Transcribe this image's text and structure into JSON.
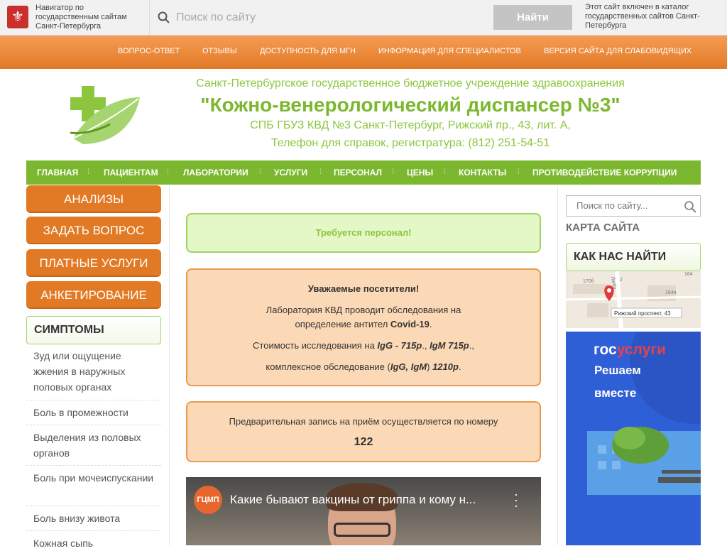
{
  "topbar": {
    "navigator_text": "Навигатор по государственным сайтам Санкт-Петербурга",
    "search_placeholder": "Поиск по сайту",
    "search_button": "Найти",
    "catalog_text": "Этот сайт включен в каталог государственных сайтов Санкт-Петербурга"
  },
  "topnav": [
    "ВОПРОС-ОТВЕТ",
    "ОТЗЫВЫ",
    "ДОСТУПНОСТЬ ДЛЯ МГН",
    "ИНФОРМАЦИЯ ДЛЯ СПЕЦИАЛИСТОВ",
    "ВЕРСИЯ САЙТА ДЛЯ СЛАБОВИДЯЩИХ"
  ],
  "header": {
    "line1": "Санкт-Петербургское государственное бюджетное учреждение здравоохранения",
    "line2": "\"Кожно-венерологический диспансер №3\"",
    "line3": "СПБ ГБУЗ КВД №3 Санкт-Петербург, Рижский пр., 43, лит. А,",
    "line4": "Телефон для справок, регистратура: (812) 251-54-51"
  },
  "mainnav": [
    "ГЛАВНАЯ",
    "ПАЦИЕНТАМ",
    "ЛАБОРАТОРИИ",
    "УСЛУГИ",
    "ПЕРСОНАЛ",
    "ЦЕНЫ",
    "КОНТАКТЫ",
    "ПРОТИВОДЕЙСТВИЕ КОРРУПЦИИ"
  ],
  "left": {
    "buttons": [
      "АНАЛИЗЫ",
      "ЗАДАТЬ ВОПРОС",
      "ПЛАТНЫЕ УСЛУГИ",
      "АНКЕТИРОВАНИЕ"
    ],
    "symptoms_title": "СИМПТОМЫ",
    "symptoms": [
      "Зуд или ощущение жжения в наружных половых органах",
      "Боль в промежности",
      "Выделения из половых органов",
      "Боль при мочеиспускании",
      "Боль внизу живота",
      "Кожная сыпь"
    ]
  },
  "center": {
    "staff_notice": "Требуется персонал!",
    "notice1": {
      "title": "Уважаемые посетители!",
      "line1": "Лаборатория КВД проводит обследования на",
      "line2a": "определение антител ",
      "line2b": "Covid-19",
      "line2c": ".",
      "line3a": "Стоимость исследования на ",
      "line3b": "IgG - 715р",
      "line3c": "., ",
      "line3d": "IgM 715р",
      "line3e": ".,",
      "line4a": "комплексное обследование (",
      "line4b": "IgG, IgM",
      "line4c": ") ",
      "line4d": "1210р",
      "line4e": "."
    },
    "notice2": {
      "text": "Предварительная запись на приём осуществляется по номеру",
      "number": "122"
    },
    "video": {
      "logo": "ГЦМП",
      "title": "Какие бывают вакцины от гриппа и кому н..."
    }
  },
  "right": {
    "search_placeholder": "Поиск по сайту...",
    "sitemap": "КАРТА САЙТА",
    "howfind": "КАК НАС НАЙТИ",
    "map_label": "Рижский проспект, 43",
    "map_marks": [
      "170б",
      "164",
      "164п",
      "Любо",
      "2"
    ],
    "banner_logo_a": "гос",
    "banner_logo_b": "услуги",
    "banner_line1": "Решаем",
    "banner_line2": "вместе"
  },
  "colors": {
    "orange": "#e27a25",
    "green": "#7cb82f",
    "light_green": "#e4f7c7",
    "peach": "#fcd9b6"
  }
}
